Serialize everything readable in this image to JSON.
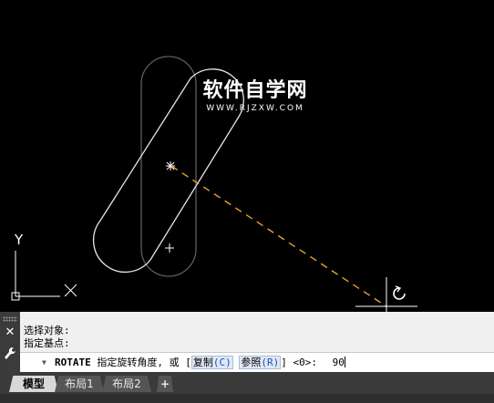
{
  "watermark": {
    "chinese": "软件自学网",
    "url": "WWW.RJZXW.COM"
  },
  "ucs": {
    "y_label": "Y"
  },
  "command": {
    "history": [
      "选择对象:",
      "指定基点:"
    ],
    "prompt_keyword": "ROTATE",
    "prompt_text": "指定旋转角度, 或 [",
    "option1_label": "复制",
    "option1_key": "(C)",
    "option2_label": "参照",
    "option2_key": "(R)",
    "prompt_suffix": "] <0>:",
    "input_value": "90"
  },
  "tabs": [
    {
      "label": "模型",
      "active": true
    },
    {
      "label": "布局1",
      "active": false
    },
    {
      "label": "布局2",
      "active": false
    },
    {
      "label": "+",
      "active": false
    }
  ],
  "colors": {
    "canvas": "#000000",
    "rubberband": "#e8a030",
    "ghost": "#5a5a5a",
    "object": "#e6e6e6"
  }
}
